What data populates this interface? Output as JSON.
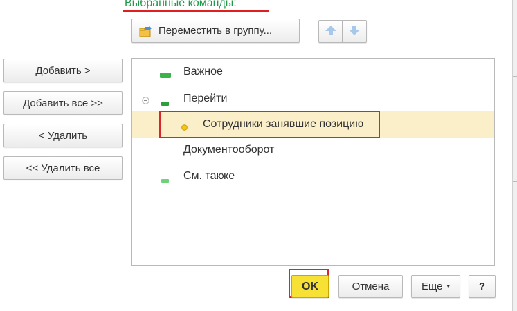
{
  "section": {
    "title": "Выбранные команды:"
  },
  "left_buttons": {
    "add": "Добавить >",
    "add_all": "Добавить все >>",
    "remove": "< Удалить",
    "remove_all": "<< Удалить все"
  },
  "toolbar": {
    "move_to_group": "Переместить в группу...",
    "move_up_icon": "arrow-up-icon",
    "move_down_icon": "arrow-down-icon"
  },
  "tree": {
    "rows": [
      {
        "label": "Важное",
        "marker": "green-bar-large"
      },
      {
        "label": "Перейти",
        "marker": "green-bar-small",
        "expanded": true
      },
      {
        "label": "Сотрудники занявшие позицию",
        "marker": "yellow-dot",
        "selected": true
      },
      {
        "label": "Документооборот",
        "marker": "none"
      },
      {
        "label": "См. также",
        "marker": "green-bar-light"
      }
    ]
  },
  "footer": {
    "ok": "OK",
    "cancel": "Отмена",
    "more": "Еще",
    "help": "?"
  },
  "colors": {
    "title_green": "#1f9a4a",
    "highlight_red": "#d8262d",
    "selected_row": "#fbefc9",
    "ok_yellow": "#f7e135"
  }
}
